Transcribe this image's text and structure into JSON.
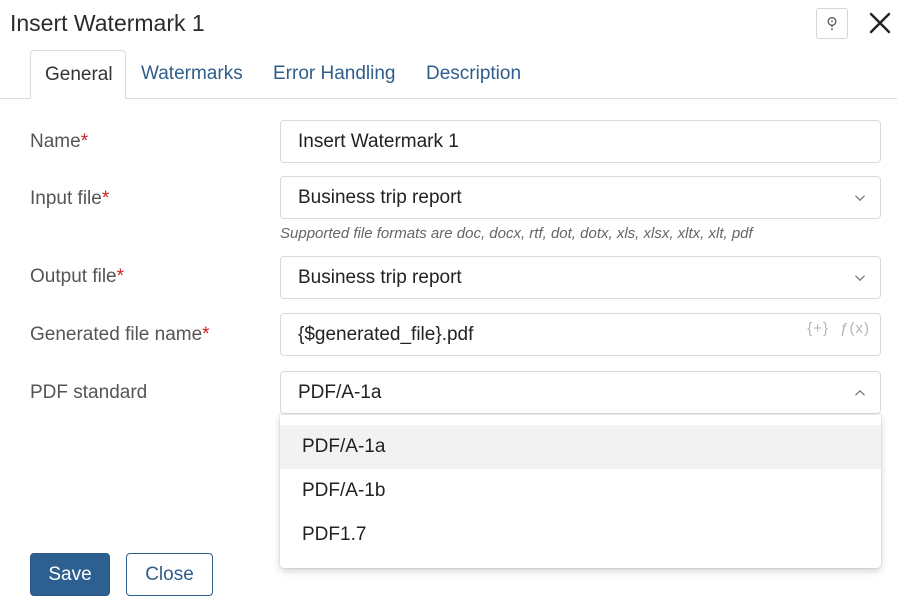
{
  "window": {
    "title": "Insert Watermark 1"
  },
  "tabs": [
    {
      "label": "General",
      "active": true
    },
    {
      "label": "Watermarks",
      "active": false
    },
    {
      "label": "Error Handling",
      "active": false
    },
    {
      "label": "Description",
      "active": false
    }
  ],
  "form": {
    "name": {
      "label": "Name",
      "required_mark": "*",
      "value": "Insert Watermark 1"
    },
    "input_file": {
      "label": "Input file",
      "required_mark": "*",
      "value": "Business trip report",
      "hint": "Supported file formats are doc, docx, rtf, dot, dotx, xls, xlsx, xltx, xlt, pdf"
    },
    "output_file": {
      "label": "Output file",
      "required_mark": "*",
      "value": "Business trip report"
    },
    "generated_file_name": {
      "label": "Generated file name",
      "required_mark": "*",
      "value": "{$generated_file}.pdf",
      "insert_var_icon": "{+}",
      "function_icon": "ƒ(x)"
    },
    "pdf_standard": {
      "label": "PDF standard",
      "value": "PDF/A-1a",
      "options": [
        "PDF/A-1a",
        "PDF/A-1b",
        "PDF1.7"
      ],
      "highlighted_option": "PDF/A-1a"
    }
  },
  "buttons": {
    "save": "Save",
    "close": "Close"
  },
  "colors": {
    "accent": "#2e5f91",
    "link": "#2f5e8c",
    "required": "#cc2222"
  }
}
